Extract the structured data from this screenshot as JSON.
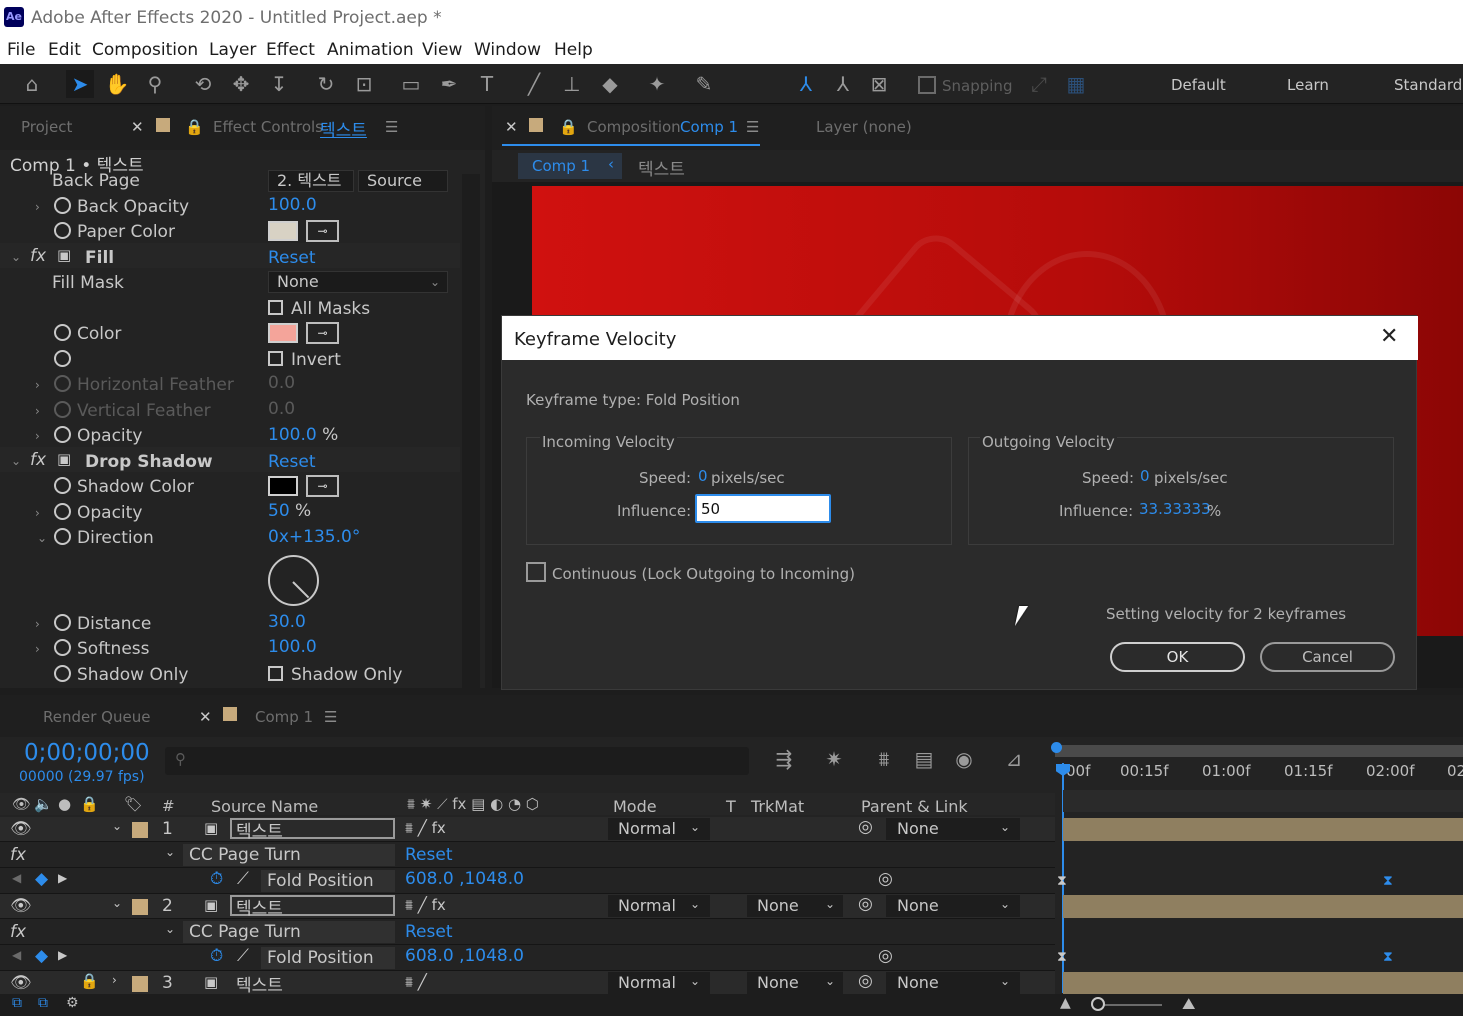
{
  "app": {
    "logo_text": "Ae",
    "title": "Adobe After Effects 2020 - Untitled Project.aep *"
  },
  "menu": [
    "File",
    "Edit",
    "Composition",
    "Layer",
    "Effect",
    "Animation",
    "View",
    "Window",
    "Help"
  ],
  "toolbar": {
    "snapping_label": "Snapping",
    "workspaces": [
      "Default",
      "Learn",
      "Standard"
    ]
  },
  "left_panel": {
    "tabs": {
      "project": "Project",
      "effect_controls": "Effect Controls",
      "layer_name": "텍스트"
    },
    "breadcrumb": "Comp 1 • 텍스트",
    "props": {
      "back_page": "Back Page",
      "back_page_layer": "2. 텍스트",
      "back_page_source": "Source",
      "back_opacity": "Back Opacity",
      "back_opacity_val": "100.0",
      "paper_color": "Paper Color",
      "fill": "Fill",
      "reset": "Reset",
      "fill_mask": "Fill Mask",
      "fill_mask_val": "None",
      "all_masks": "All Masks",
      "color": "Color",
      "invert": "Invert",
      "horizontal_feather": "Horizontal Feather",
      "h_feather_val": "0.0",
      "vertical_feather": "Vertical Feather",
      "v_feather_val": "0.0",
      "opacity": "Opacity",
      "opacity_val": "100.0",
      "percent": "%",
      "drop_shadow": "Drop Shadow",
      "shadow_color": "Shadow Color",
      "ds_opacity_val": "50",
      "direction": "Direction",
      "direction_turns": "0x",
      "direction_deg": "+135.0",
      "degree": "°",
      "distance": "Distance",
      "distance_val": "30.0",
      "softness": "Softness",
      "softness_val": "100.0",
      "shadow_only": "Shadow Only",
      "shadow_only_chk": "Shadow Only"
    },
    "colors": {
      "paper": "#d8d2c4",
      "fill": "#f4a49a",
      "shadow": "#000000"
    }
  },
  "comp_panel": {
    "tab_label": "Composition",
    "comp_name": "Comp 1",
    "layer_tab": "Layer (none)",
    "crumb_comp": "Comp 1",
    "crumb_layer": "텍스트"
  },
  "dialog": {
    "title": "Keyframe Velocity",
    "keyframe_type": "Keyframe type: Fold Position",
    "incoming": {
      "label": "Incoming Velocity",
      "speed_label": "Speed:",
      "speed_val": "0",
      "speed_unit": "pixels/sec",
      "influence_label": "Influence:",
      "influence_val": "50"
    },
    "outgoing": {
      "label": "Outgoing Velocity",
      "speed_label": "Speed:",
      "speed_val": "0",
      "speed_unit": "pixels/sec",
      "influence_label": "Influence:",
      "influence_val": "33.33333",
      "influence_unit": "%"
    },
    "continuous": "Continuous (Lock Outgoing to Incoming)",
    "status": "Setting velocity for 2 keyframes",
    "ok": "OK",
    "cancel": "Cancel"
  },
  "timeline": {
    "tabs": {
      "render_queue": "Render Queue",
      "comp": "Comp 1"
    },
    "timecode": "0;00;00;00",
    "frames": "00000 (29.97 fps)",
    "columns": {
      "num": "#",
      "source": "Source Name",
      "mode": "Mode",
      "t": "T",
      "trkmat": "TrkMat",
      "parent": "Parent & Link"
    },
    "ruler": [
      "00f",
      "00:15f",
      "01:00f",
      "01:15f",
      "02:00f",
      "02"
    ],
    "rows": [
      {
        "num": "1",
        "name": "텍스트",
        "mode": "Normal",
        "trkmat": "",
        "parent": "None",
        "effect": "CC Page Turn",
        "reset": "Reset",
        "prop": "Fold Position",
        "value": "608.0 ,1048.0"
      },
      {
        "num": "2",
        "name": "텍스트",
        "mode": "Normal",
        "trkmat": "None",
        "parent": "None",
        "effect": "CC Page Turn",
        "reset": "Reset",
        "prop": "Fold Position",
        "value": "608.0 ,1048.0"
      },
      {
        "num": "3",
        "name": "텍스트",
        "mode": "Normal",
        "trkmat": "None",
        "parent": "None"
      }
    ]
  }
}
